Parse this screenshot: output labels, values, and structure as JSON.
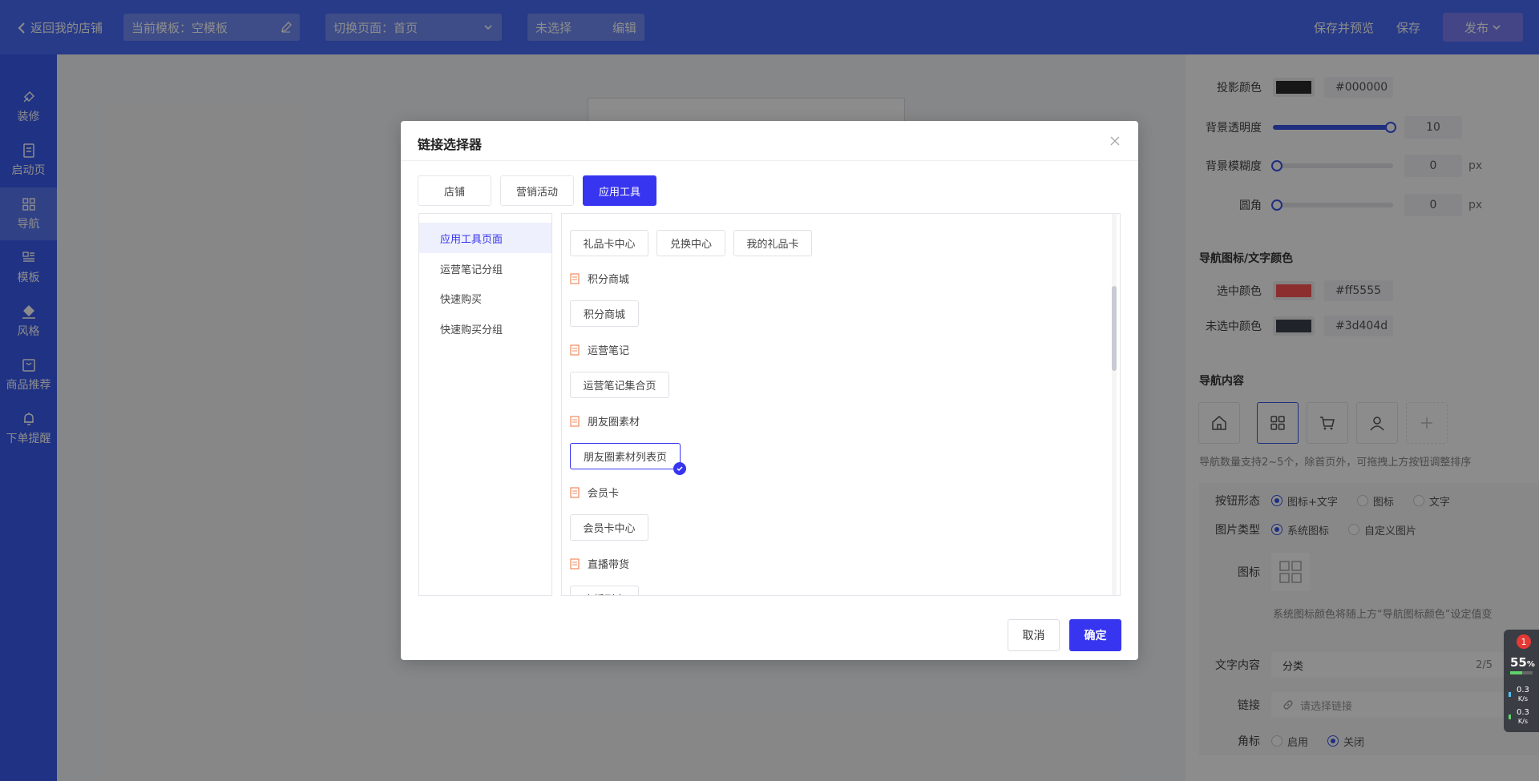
{
  "topbar": {
    "back_label": "返回我的店铺",
    "template_label": "当前模板：空模板",
    "page_switch_label": "切换页面：首页",
    "unselected_label": "未选择",
    "edit_label": "编辑",
    "save_preview_label": "保存并预览",
    "save_label": "保存",
    "publish_label": "发布"
  },
  "sidebar": {
    "items": [
      {
        "label": "装修",
        "icon": "brush-icon"
      },
      {
        "label": "启动页",
        "icon": "document-icon"
      },
      {
        "label": "导航",
        "icon": "grid-icon"
      },
      {
        "label": "模板",
        "icon": "layout-icon"
      },
      {
        "label": "风格",
        "icon": "paint-bucket-icon"
      },
      {
        "label": "商品推荐",
        "icon": "bag-icon"
      },
      {
        "label": "下单提醒",
        "icon": "bell-icon"
      }
    ],
    "active_index": 2
  },
  "right_panel": {
    "shadow_color_label": "投影颜色",
    "shadow_color_hex": "#000000",
    "bg_opacity_label": "背景透明度",
    "bg_opacity_value": "10",
    "bg_opacity_fraction": 1.0,
    "bg_blur_label": "背景模糊度",
    "bg_blur_value": "0",
    "bg_blur_unit": "px",
    "radius_label": "圆角",
    "radius_value": "0",
    "radius_unit": "px",
    "nav_color_section": "导航图标/文字颜色",
    "selected_color_label": "选中颜色",
    "selected_color_hex": "#ff5555",
    "unselected_color_label": "未选中颜色",
    "unselected_color_hex": "#3d404d",
    "nav_content_section": "导航内容",
    "nav_tip": "导航数量支持2~5个，除首页外，可拖拽上方按钮调整排序",
    "button_form_label": "按钮形态",
    "button_form_options": [
      "图标+文字",
      "图标",
      "文字"
    ],
    "image_type_label": "图片类型",
    "image_type_options": [
      "系统图标",
      "自定义图片"
    ],
    "icon_label": "图标",
    "icon_tip": "系统图标颜色将随上方“导航图标颜色”设定值变",
    "text_content_label": "文字内容",
    "text_content_value": "分类",
    "text_count": "2/5",
    "link_label": "链接",
    "link_placeholder": "请选择链接",
    "badge_label": "角标",
    "badge_options": [
      "启用",
      "关闭"
    ]
  },
  "modal": {
    "title": "链接选择器",
    "tabs": [
      "店铺",
      "营销活动",
      "应用工具"
    ],
    "active_tab": 2,
    "categories": [
      "应用工具页面",
      "运营笔记分组",
      "快速购买",
      "快速购买分组"
    ],
    "active_category": 0,
    "top_chips": [
      "礼品卡中心",
      "兑换中心",
      "我的礼品卡"
    ],
    "groups": [
      {
        "title": "积分商城",
        "chips": [
          "积分商城"
        ]
      },
      {
        "title": "运营笔记",
        "chips": [
          "运营笔记集合页"
        ]
      },
      {
        "title": "朋友圈素材",
        "chips": [
          "朋友圈素材列表页"
        ]
      },
      {
        "title": "会员卡",
        "chips": [
          "会员卡中心"
        ]
      },
      {
        "title": "直播带货",
        "chips": [
          "直播列表"
        ]
      }
    ],
    "selected_chip": "朋友圈素材列表页",
    "cancel_label": "取消",
    "ok_label": "确定"
  },
  "widget": {
    "badge": "1",
    "percent": "55",
    "percent_unit": "%",
    "upload_speed": "0.3",
    "download_speed": "0.3",
    "speed_unit": "K/s"
  },
  "colors": {
    "primary": "#3735f0",
    "topbar": "#4a6cf7",
    "sidebar": "#3a5bf0",
    "shadow_swatch": "#000000",
    "selected_swatch": "#ff5555",
    "unselected_swatch": "#3d404d"
  }
}
